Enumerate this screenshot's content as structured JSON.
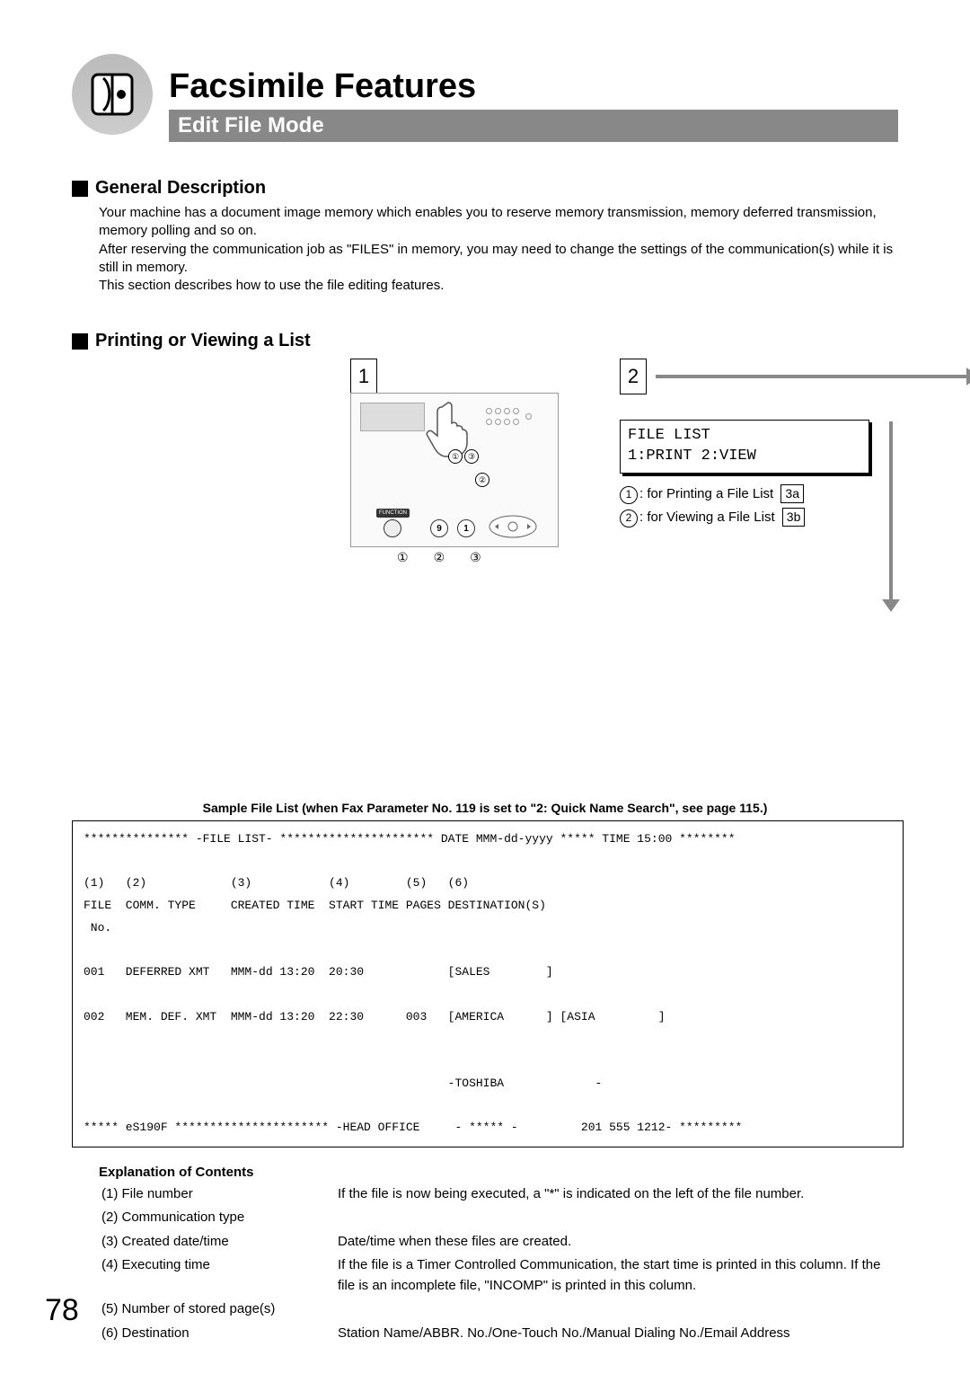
{
  "chapter_title": "Facsimile Features",
  "section_bar": "Edit File Mode",
  "headings": {
    "h1": "General Description",
    "h2": "Printing or Viewing a List"
  },
  "general_description": {
    "p1": "Your machine has a document image memory which enables you to reserve memory transmission, memory deferred transmission, memory polling and so on.",
    "p2": "After reserving the communication  job as \"FILES\" in memory, you may need to change the settings of the communication(s) while it is still in memory.",
    "p3": "This section describes how to use the file editing features."
  },
  "steps": {
    "step1_num": "1",
    "step2_num": "2",
    "step1_caption_1": "①",
    "step1_caption_2": "②",
    "step1_caption_3": "③",
    "panel_function_label": "FUNCTION",
    "panel_key9": "9",
    "panel_key1": "1",
    "panel_mark_1": "①",
    "panel_mark_2": "②",
    "panel_mark_3": "③",
    "lcd_line1": "FILE LIST",
    "lcd_line2": "1:PRINT 2:VIEW",
    "opt1_num": "1",
    "opt1_text": ": for Printing a File List",
    "opt1_link": "3a",
    "opt2_num": "2",
    "opt2_text": ": for Viewing a File List",
    "opt2_link": "3b"
  },
  "sample_caption": "Sample File List (when Fax Parameter No. 119 is set to \"2: Quick Name Search\", see page 115.)",
  "file_list_text": "*************** -FILE LIST- ********************** DATE MMM-dd-yyyy ***** TIME 15:00 ********\n\n(1)   (2)            (3)           (4)        (5)   (6)\nFILE  COMM. TYPE     CREATED TIME  START TIME PAGES DESTINATION(S)\n No.\n\n001   DEFERRED XMT   MMM-dd 13:20  20:30            [SALES        ]\n\n002   MEM. DEF. XMT  MMM-dd 13:20  22:30      003   [AMERICA      ] [ASIA         ]\n\n\n                                                    -TOSHIBA             -\n\n***** eS190F ********************** -HEAD OFFICE     - ***** -         201 555 1212- *********",
  "explanation": {
    "heading": "Explanation of Contents",
    "rows": [
      {
        "left": "(1) File number",
        "right": "If the file is now being executed, a \"*\" is indicated on the left of the file number."
      },
      {
        "left": "(2) Communication type",
        "right": ""
      },
      {
        "left": "(3) Created date/time",
        "right": "Date/time when these files are created."
      },
      {
        "left": "(4) Executing time",
        "right": "If the file is a Timer Controlled Communication, the start time is printed in this column. If the file is an incomplete file, \"INCOMP\" is printed in this column."
      },
      {
        "left": "(5) Number of stored page(s)",
        "right": ""
      },
      {
        "left": "(6) Destination",
        "right": "Station Name/ABBR. No./One-Touch No./Manual Dialing No./Email Address"
      }
    ]
  },
  "page_number": "78"
}
